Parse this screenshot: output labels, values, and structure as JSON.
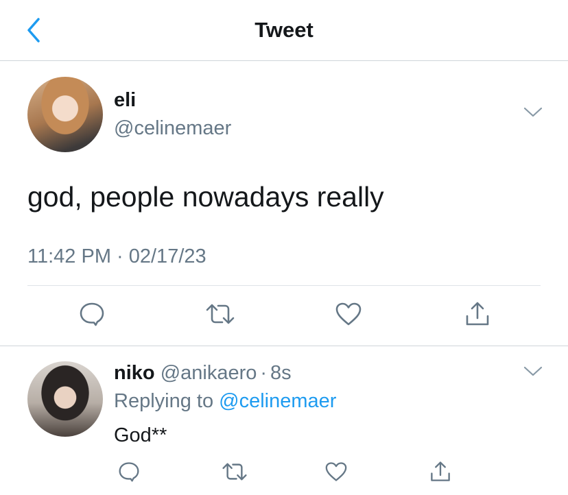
{
  "header": {
    "title": "Tweet",
    "back_icon": "chevron-left-icon",
    "accent_color": "#1d9bf0"
  },
  "main_tweet": {
    "display_name": "eli",
    "handle": "@celinemaer",
    "text": "god, people nowadays really",
    "timestamp": "11:42 PM · 02/17/23",
    "menu_icon": "chevron-down-icon",
    "actions": [
      "reply-icon",
      "retweet-icon",
      "like-icon",
      "share-icon"
    ]
  },
  "reply": {
    "display_name": "niko",
    "handle": "@anikaero",
    "separator": "·",
    "time": "8s",
    "replying_label": "Replying to",
    "replying_to": "@celinemaer",
    "text": "God**",
    "menu_icon": "chevron-down-icon",
    "actions": [
      "reply-icon",
      "retweet-icon",
      "like-icon",
      "share-icon"
    ]
  }
}
